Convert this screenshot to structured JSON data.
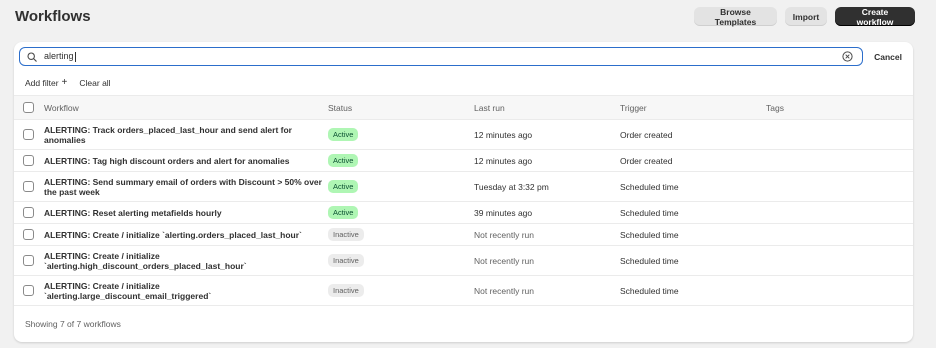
{
  "header": {
    "title": "Workflows",
    "browse_label": "Browse Templates",
    "import_label": "Import",
    "create_label": "Create workflow"
  },
  "search": {
    "value": "alerting",
    "cancel_label": "Cancel"
  },
  "filters": {
    "add_filter_label": "Add filter",
    "clear_all_label": "Clear all"
  },
  "table": {
    "columns": [
      "Workflow",
      "Status",
      "Last run",
      "Trigger",
      "Tags"
    ],
    "rows": [
      {
        "name": "ALERTING: Track orders_placed_last_hour and send alert for anomalies",
        "status": "Active",
        "last_run": "12 minutes ago",
        "trigger": "Order created"
      },
      {
        "name": "ALERTING: Tag high discount orders and alert for anomalies",
        "status": "Active",
        "last_run": "12 minutes ago",
        "trigger": "Order created"
      },
      {
        "name": "ALERTING: Send summary email of orders with Discount > 50% over the past week",
        "status": "Active",
        "last_run": "Tuesday at 3:32 pm",
        "trigger": "Scheduled time"
      },
      {
        "name": "ALERTING: Reset alerting metafields hourly",
        "status": "Active",
        "last_run": "39 minutes ago",
        "trigger": "Scheduled time"
      },
      {
        "name": "ALERTING: Create / initialize `alerting.orders_placed_last_hour`",
        "status": "Inactive",
        "last_run": "Not recently run",
        "trigger": "Scheduled time"
      },
      {
        "name": "ALERTING: Create / initialize `alerting.high_discount_orders_placed_last_hour`",
        "status": "Inactive",
        "last_run": "Not recently run",
        "trigger": "Scheduled time"
      },
      {
        "name": "ALERTING: Create / initialize `alerting.large_discount_email_triggered`",
        "status": "Inactive",
        "last_run": "Not recently run",
        "trigger": "Scheduled time"
      }
    ]
  },
  "footer": {
    "summary": "Showing 7 of 7 workflows"
  },
  "colors": {
    "active_badge_bg": "#aff6b4",
    "inactive_badge_bg": "#ececec",
    "primary_button": "#303030",
    "focus_border": "#2c6ecb"
  }
}
